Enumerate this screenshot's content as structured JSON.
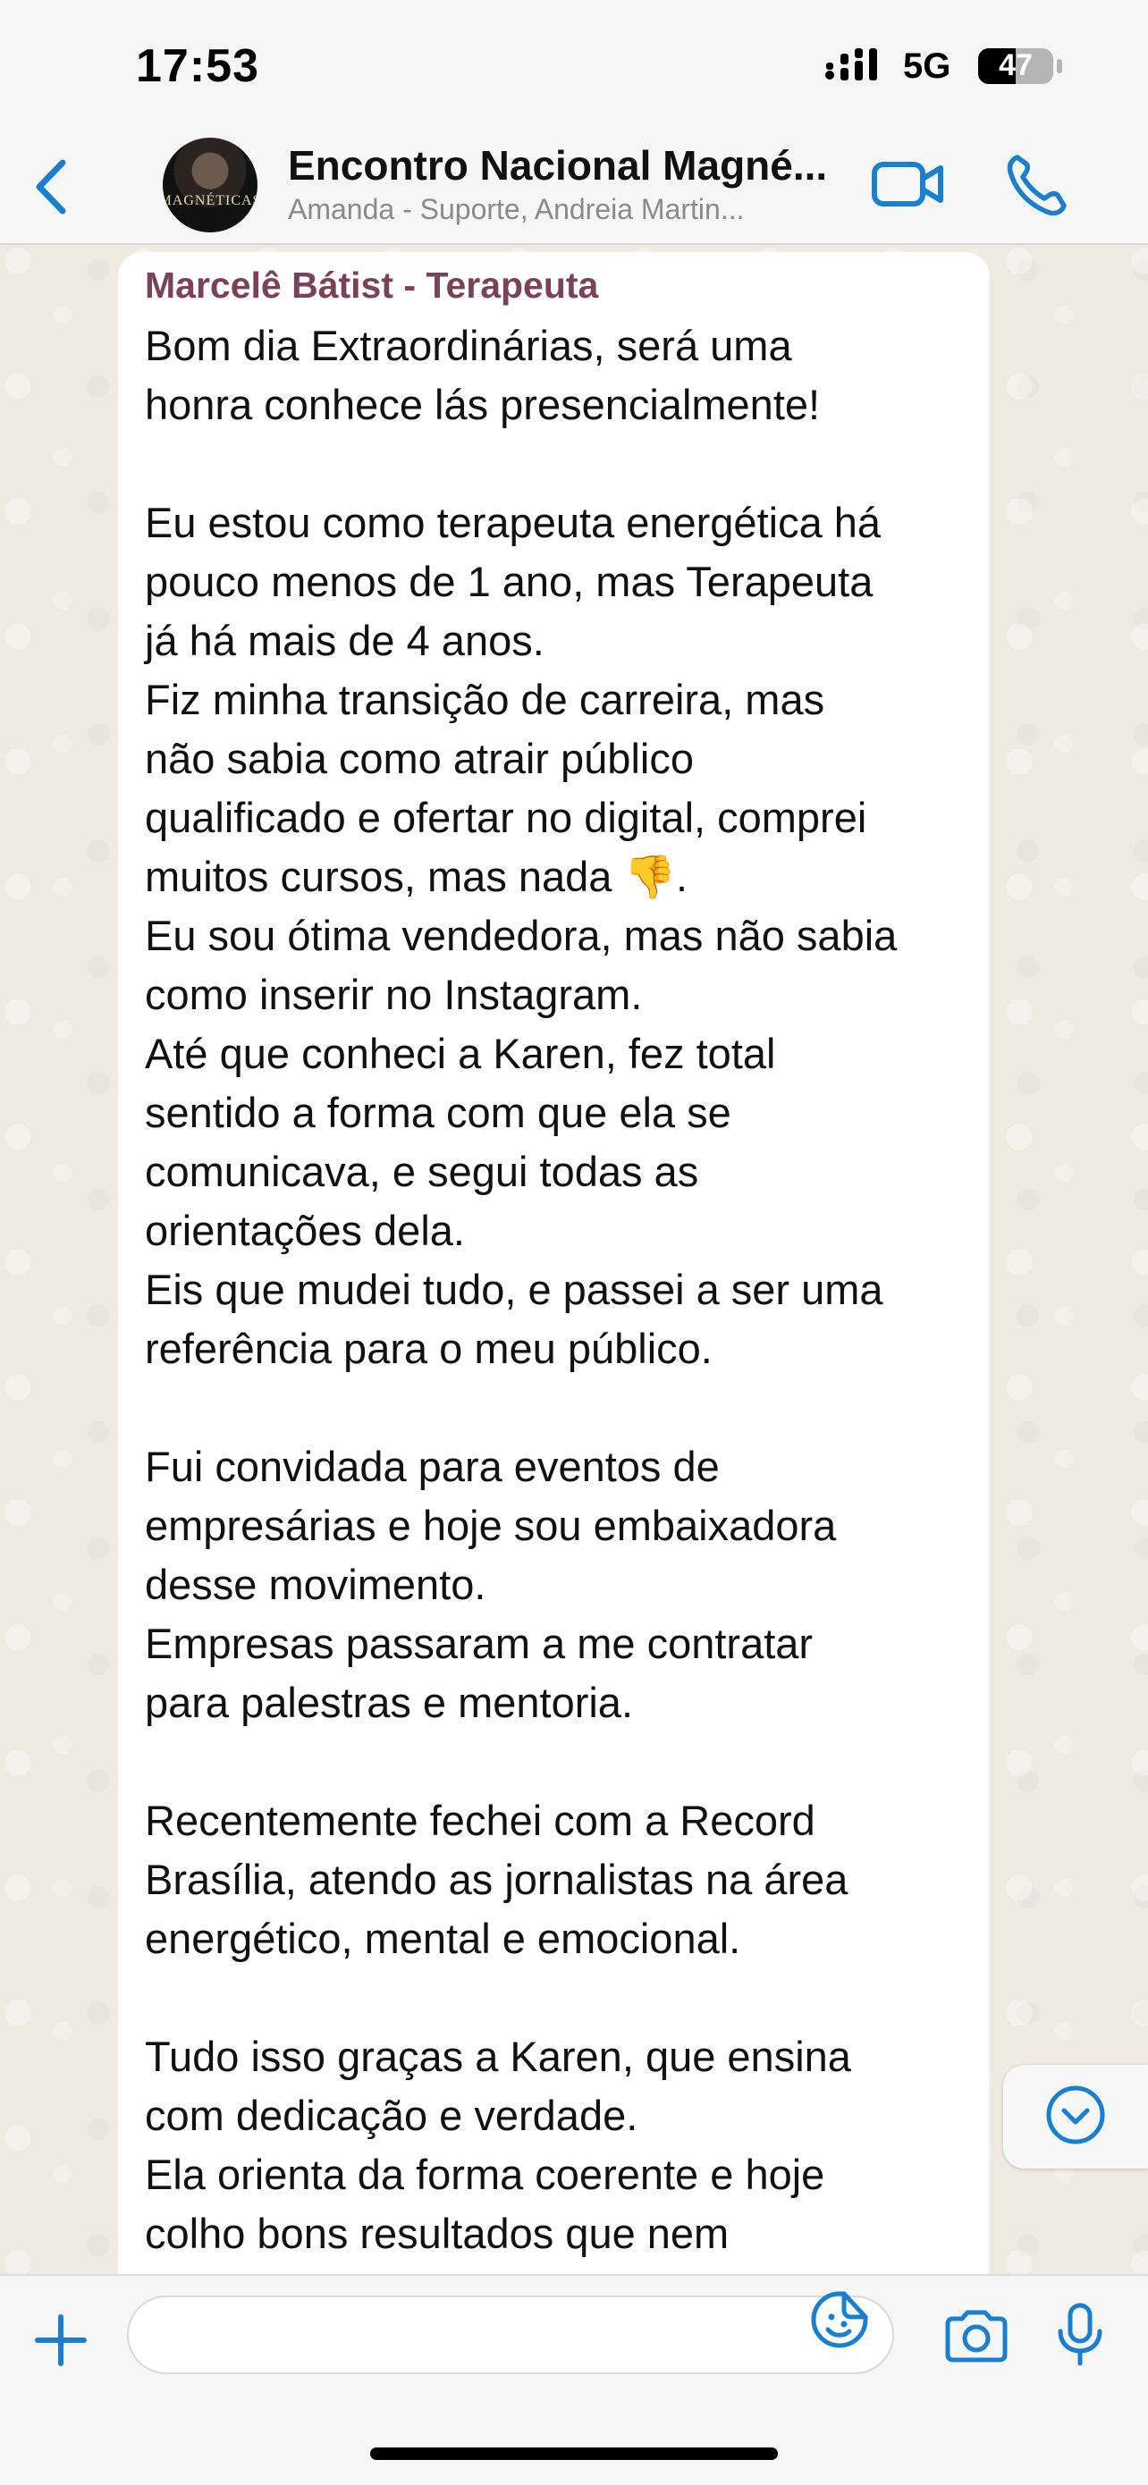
{
  "status_bar": {
    "time": "17:53",
    "network": "5G",
    "battery_level": "47"
  },
  "header": {
    "title": "Encontro Nacional Magné...",
    "subtitle": "Amanda - Suporte, Andreia Martin...",
    "avatar_text": "MAGNÉTICAS",
    "icons": [
      "back-chevron-icon",
      "video-call-icon",
      "phone-icon"
    ]
  },
  "message": {
    "sender": "Marcelê Bátist - Terapeuta",
    "sender_color": "#7a4259",
    "text": "Bom dia Extraordinárias, será uma\nhonra conhece lás presencialmente!\n\nEu estou como terapeuta energética há\npouco menos de 1 ano, mas Terapeuta\njá há mais de 4 anos.\nFiz minha transição de carreira, mas\nnão sabia como atrair público\nqualificado e ofertar no digital, comprei\nmuitos cursos, mas nada 👎.\nEu sou ótima vendedora, mas não sabia\ncomo inserir no Instagram.\nAté que conheci a Karen, fez total\nsentido a forma com que ela se\ncomunicava, e segui todas as\norientações dela.\nEis que mudei tudo, e passei a ser uma\nreferência para o meu público.\n\nFui convidada para eventos de\nempresárias e hoje sou embaixadora\ndesse movimento.\nEmpresas passaram a me contratar\npara palestras e mentoria.\n\nRecentemente fechei com a Record\nBrasília, atendo as jornalistas na área\nenergético, mental e emocional.\n\nTudo isso graças a Karen, que ensina\ncom dedicação e verdade.\nEla orienta da forma coerente e hoje\ncolho bons resultados que nem"
  },
  "composer": {
    "input_value": "",
    "icons": [
      "plus-icon",
      "sticker-icon",
      "camera-icon",
      "microphone-icon"
    ]
  },
  "colors": {
    "accent": "#1a7fd1",
    "chat_background": "#efeae2",
    "bubble": "#ffffff"
  }
}
